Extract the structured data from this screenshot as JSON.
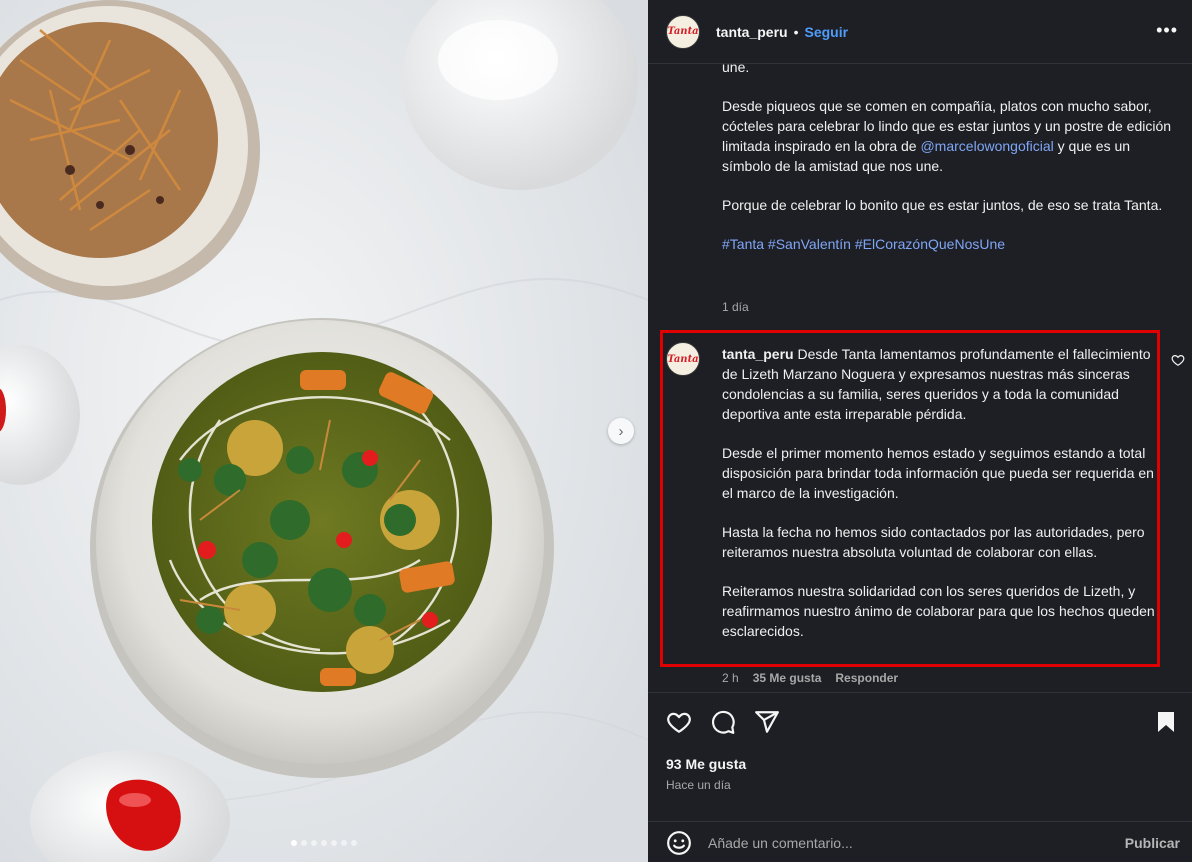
{
  "header": {
    "username": "tanta_peru",
    "separator": "•",
    "follow_label": "Seguir",
    "more_label": "•••",
    "avatar_text": "Tanta"
  },
  "caption": {
    "top_fragment": "une.",
    "paragraph_2_pre": "Desde piqueos que se comen en compañía, platos con mucho sabor, cócteles para celebrar lo lindo que es estar juntos y un postre de edición limitada inspirado en la obra de ",
    "mention": "@marcelowongoficial",
    "paragraph_2_post": " y que es un símbolo de la amistad que nos une.",
    "paragraph_3": "Porque de celebrar lo bonito que es estar juntos, de eso se trata Tanta.",
    "hashtags": "#Tanta #SanValentín #ElCorazónQueNosUne",
    "time": "1 día"
  },
  "comment": {
    "username": "tanta_peru",
    "p1": " Desde Tanta lamentamos profundamente el fallecimiento de Lizeth Marzano Noguera y expresamos nuestras más sinceras condolencias a su familia, seres queridos y a toda la comunidad deportiva ante esta irreparable pérdida.",
    "p2": "Desde el primer momento hemos estado y seguimos estando a total disposición para brindar toda información que pueda ser requerida en el marco de la investigación.",
    "p3": "Hasta la fecha no hemos sido contactados por las autoridades, pero reiteramos nuestra absoluta voluntad de colaborar con ellas.",
    "p4": "Reiteramos nuestra solidaridad con los seres queridos de Lizeth, y reafirmamos nuestro ánimo de colaborar para que los hechos queden esclarecidos.",
    "time": "2 h",
    "likes": "35 Me gusta",
    "reply_label": "Responder",
    "highlight_color": "#e00000"
  },
  "actions": {
    "icons": [
      "heart-icon",
      "comment-icon",
      "share-icon",
      "bookmark-icon"
    ],
    "likes": "93 Me gusta",
    "when": "Hace un día"
  },
  "add_comment": {
    "placeholder": "Añade un comentario...",
    "publish_label": "Publicar"
  },
  "carousel": {
    "slide_count": 7,
    "active_index": 0
  },
  "colors": {
    "link": "#4f9cf9",
    "mention": "#7fa6f5",
    "panel_bg": "#1d1f24"
  }
}
